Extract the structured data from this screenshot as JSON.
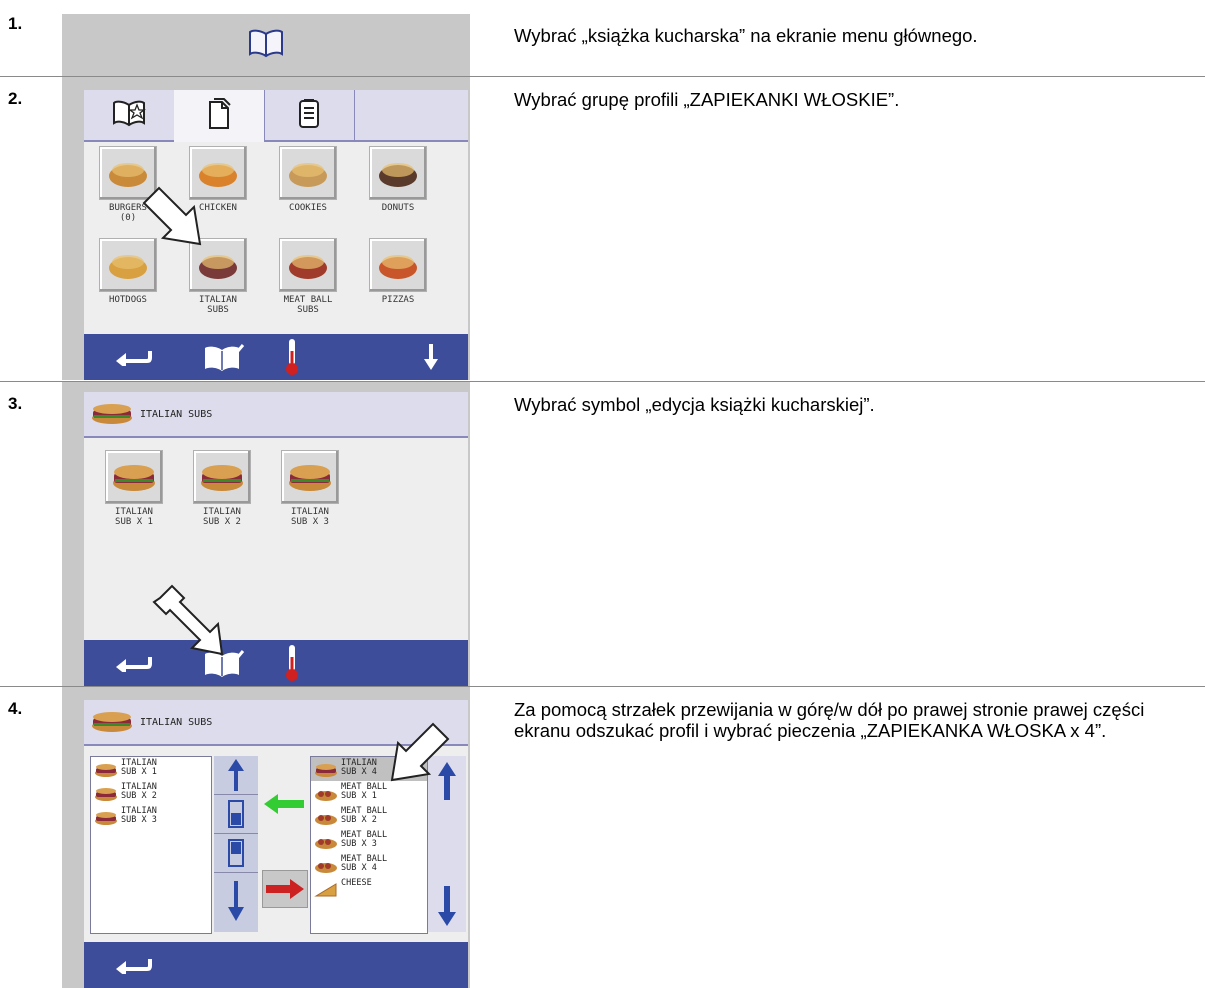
{
  "steps": [
    {
      "number": "1.",
      "text": "Wybrać „książka kucharska” na ekranie menu głównego."
    },
    {
      "number": "2.",
      "text": "Wybrać grupę profili „ZAPIEKANKI WŁOSKIE”."
    },
    {
      "number": "3.",
      "text": "Wybrać symbol „edycja książki kucharskiej”."
    },
    {
      "number": "4.",
      "text": "Za pomocą strzałek przewijania w górę/w dół po prawej stronie prawej części ekranu odszukać profil i wybrać pieczenia „ZAPIEKANKA WŁOSKA x 4”."
    }
  ],
  "screen2": {
    "tabs": [
      "favorites-book-icon",
      "cookbook-pages-icon",
      "notepad-icon"
    ],
    "groups": [
      {
        "label": "BURGERS\n(0)",
        "icon": "burger-icon",
        "color": "#c98a3a"
      },
      {
        "label": "CHICKEN",
        "icon": "chicken-icon",
        "color": "#d9822b"
      },
      {
        "label": "COOKIES",
        "icon": "cookies-icon",
        "color": "#c89a5a"
      },
      {
        "label": "DONUTS",
        "icon": "donuts-icon",
        "color": "#5a3a2a"
      },
      {
        "label": "HOTDOGS",
        "icon": "hotdog-icon",
        "color": "#d8a040"
      },
      {
        "label": "ITALIAN\nSUBS",
        "icon": "italian-sub-icon",
        "color": "#7a3a3a"
      },
      {
        "label": "MEAT BALL\nSUBS",
        "icon": "meatball-sub-icon",
        "color": "#a03a2a"
      },
      {
        "label": "PIZZAS",
        "icon": "pizza-icon",
        "color": "#c8562a"
      }
    ]
  },
  "screen3": {
    "header": "ITALIAN SUBS",
    "items": [
      "ITALIAN\nSUB X 1",
      "ITALIAN\nSUB X 2",
      "ITALIAN\nSUB X 3"
    ]
  },
  "screen4": {
    "header": "ITALIAN SUBS",
    "left_list": [
      "ITALIAN\nSUB X 1",
      "ITALIAN\nSUB X 2",
      "ITALIAN\nSUB X 3"
    ],
    "right_list": [
      "ITALIAN\nSUB X 4",
      "MEAT BALL\nSUB X 1",
      "MEAT BALL\nSUB X 2",
      "MEAT BALL\nSUB X 3",
      "MEAT BALL\nSUB X 4",
      "CHEESE"
    ]
  },
  "colors": {
    "bar": "#3d4d99",
    "frame": "#c8c8c8",
    "arrow_blue": "#2b4aa8",
    "arrow_green": "#33cc33",
    "arrow_red": "#cc2222"
  }
}
